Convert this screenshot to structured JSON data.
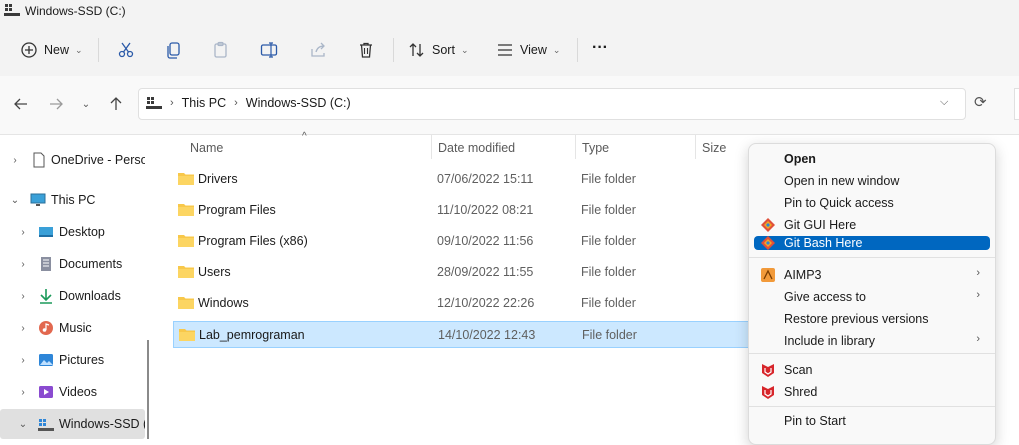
{
  "window": {
    "title": "Windows-SSD (C:)"
  },
  "toolbar": {
    "new_label": "New",
    "sort_label": "Sort",
    "view_label": "View",
    "more_label": "···",
    "icons": [
      "plus-circle-icon",
      "cut-icon",
      "copy-icon",
      "paste-icon",
      "rename-icon",
      "share-icon",
      "delete-icon",
      "sort-icon",
      "view-icon"
    ]
  },
  "address": {
    "crumbs": [
      "This PC",
      "Windows-SSD (C:)"
    ],
    "chevron": "⌵",
    "refresh": "⟳"
  },
  "sidebar": {
    "items": [
      {
        "label": "OneDrive - Perso",
        "icon": "document-icon",
        "chevron": "›"
      },
      {
        "label": "This PC",
        "icon": "monitor-icon",
        "chevron": "⌄"
      },
      {
        "label": "Desktop",
        "icon": "desktop-icon",
        "chevron": "›"
      },
      {
        "label": "Documents",
        "icon": "documents-icon",
        "chevron": "›"
      },
      {
        "label": "Downloads",
        "icon": "download-icon",
        "chevron": "›"
      },
      {
        "label": "Music",
        "icon": "music-icon",
        "chevron": "›"
      },
      {
        "label": "Pictures",
        "icon": "pictures-icon",
        "chevron": "›"
      },
      {
        "label": "Videos",
        "icon": "videos-icon",
        "chevron": "›"
      },
      {
        "label": "Windows-SSD (",
        "icon": "drive-icon",
        "chevron": "⌄"
      }
    ]
  },
  "columns": {
    "name": "Name",
    "date": "Date modified",
    "type": "Type",
    "size": "Size"
  },
  "files": [
    {
      "name": "Drivers",
      "date": "07/06/2022 15:11",
      "type": "File folder"
    },
    {
      "name": "Program Files",
      "date": "11/10/2022 08:21",
      "type": "File folder"
    },
    {
      "name": "Program Files (x86)",
      "date": "09/10/2022 11:56",
      "type": "File folder"
    },
    {
      "name": "Users",
      "date": "28/09/2022 11:55",
      "type": "File folder"
    },
    {
      "name": "Windows",
      "date": "12/10/2022 22:26",
      "type": "File folder"
    },
    {
      "name": "Lab_pemrograman",
      "date": "14/10/2022 12:43",
      "type": "File folder"
    }
  ],
  "context_menu": {
    "items": [
      {
        "label": "Open"
      },
      {
        "label": "Open in new window"
      },
      {
        "label": "Pin to Quick access"
      },
      {
        "label": "Git GUI Here",
        "icon": "git-icon"
      },
      {
        "label": "Git Bash Here",
        "icon": "git-icon"
      },
      {
        "label": "AIMP3",
        "icon": "aimp-icon",
        "arrow": "›"
      },
      {
        "label": "Give access to",
        "arrow": "›"
      },
      {
        "label": "Restore previous versions"
      },
      {
        "label": "Include in library",
        "arrow": "›"
      },
      {
        "label": "Scan",
        "icon": "mcafee-icon"
      },
      {
        "label": "Shred",
        "icon": "mcafee-icon"
      },
      {
        "label": "Pin to Start"
      }
    ]
  },
  "colors": {
    "accent": "#0067c0",
    "selection": "#cce8ff",
    "folder": "#f8c84a"
  }
}
